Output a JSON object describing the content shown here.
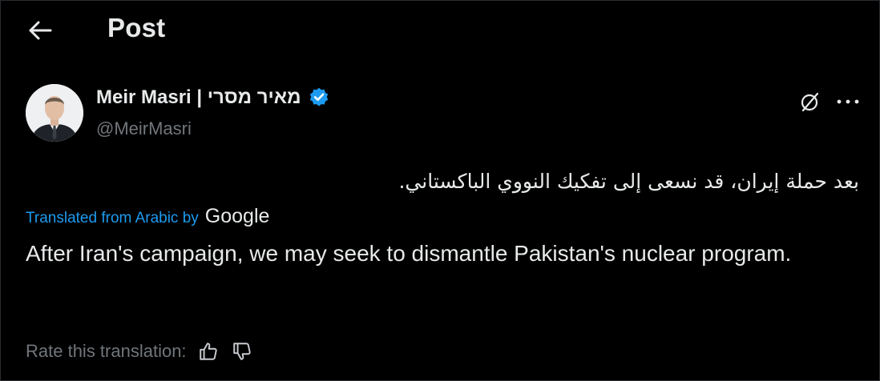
{
  "header": {
    "title": "Post",
    "back_icon": "arrow-left-icon"
  },
  "author": {
    "display_name": "Meir Masri | מאיר מסרי",
    "handle": "@MeirMasri",
    "verified_color": "#1d9bf0"
  },
  "post": {
    "original_text": "بعد حملة إيران، قد نسعى إلى تفكيك النووي الباكستاني.",
    "translated_from_label": "Translated from Arabic by",
    "translator_name": "Google",
    "translation": "After Iran's campaign, we may seek to dismantle Pakistan's nuclear program."
  },
  "rating": {
    "label": "Rate this translation:",
    "up_icon": "thumbs-up-icon",
    "down_icon": "thumbs-down-icon"
  },
  "colors": {
    "background": "#000000",
    "text": "#e7e9ea",
    "muted": "#71767b",
    "accent": "#1d9bf0"
  }
}
